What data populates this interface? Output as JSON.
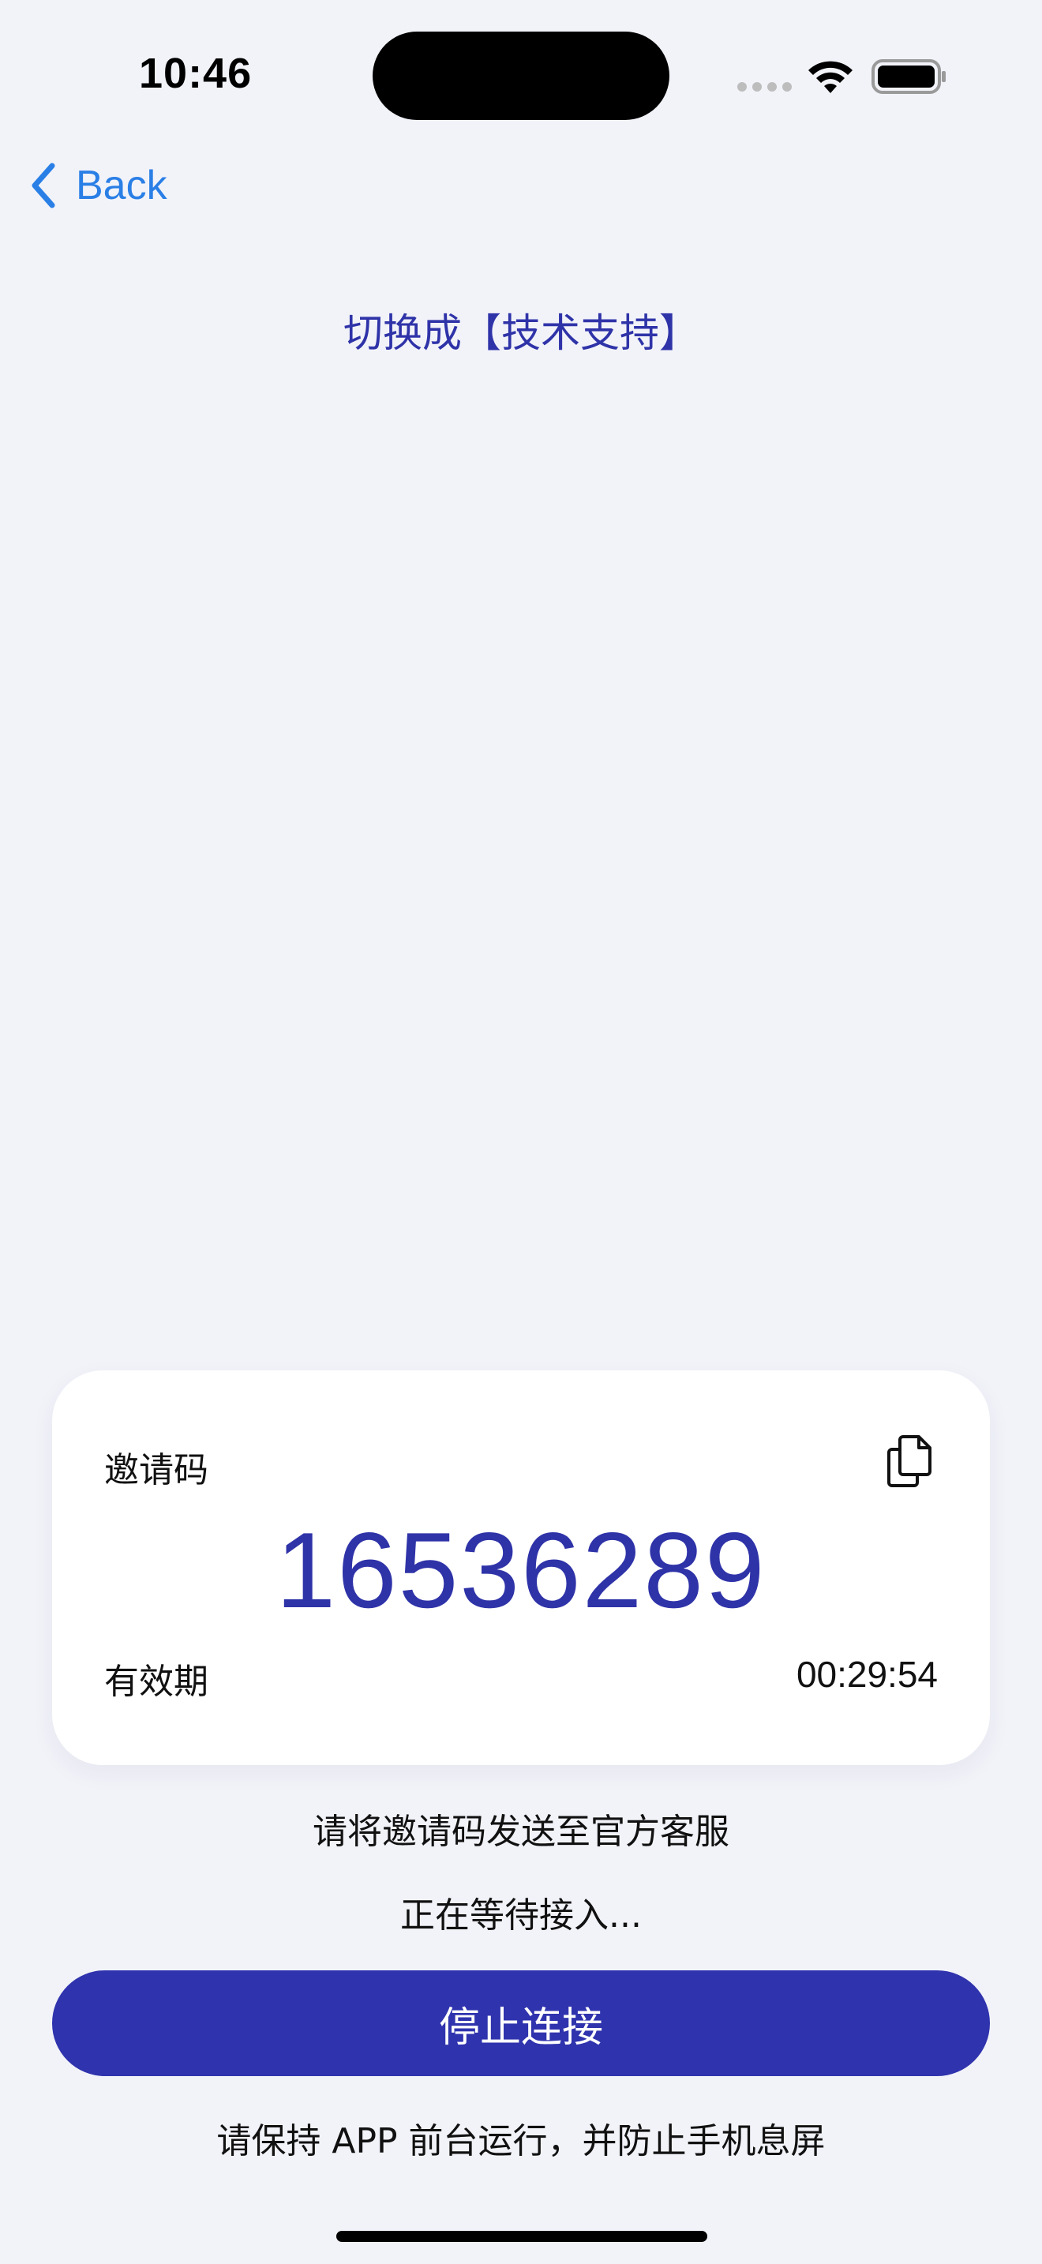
{
  "status_bar": {
    "time": "10:46",
    "icons": [
      "signal-icon",
      "wifi-icon",
      "battery-icon"
    ]
  },
  "nav": {
    "back_label": "Back",
    "back_icon": "chevron-left-icon"
  },
  "page": {
    "title": "切换成【技术支持】"
  },
  "card": {
    "invite_label": "邀请码",
    "invite_code": "16536289",
    "copy_icon": "copy-icon",
    "validity_label": "有效期",
    "validity_time": "00:29:54"
  },
  "messages": {
    "send_to_support": "请将邀请码发送至官方客服",
    "waiting": "正在等待接入...",
    "keep_foreground": "请保持 APP 前台运行，并防止手机息屏"
  },
  "actions": {
    "stop_label": "停止连接"
  },
  "colors": {
    "background": "#f2f3f9",
    "accent": "#2f33ad",
    "link": "#2a7fe6",
    "card": "#ffffff"
  }
}
